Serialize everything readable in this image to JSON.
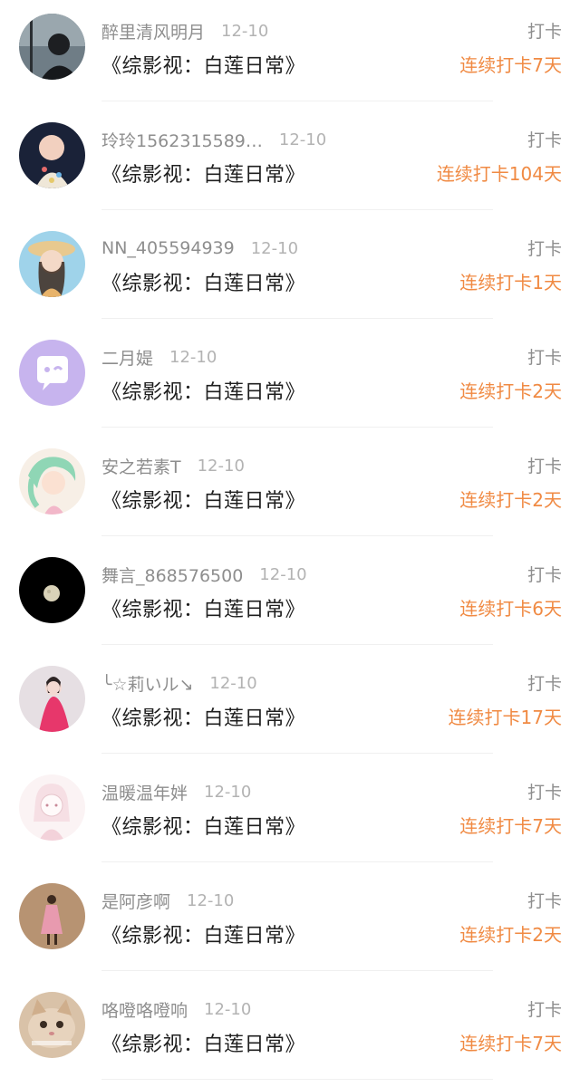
{
  "colors": {
    "streak": "#f08a43",
    "username": "#8e8e8e",
    "date": "#b3b3b3",
    "book": "#1f1f1f"
  },
  "feed": [
    {
      "username": "醉里清风明月",
      "date": "12-10",
      "book": "《综影视：白莲日常》",
      "action": "打卡",
      "streak": "连续打卡7天",
      "avatar": "dark-portrait"
    },
    {
      "username": "玲玲1562315589…",
      "date": "12-10",
      "book": "《综影视：白莲日常》",
      "action": "打卡",
      "streak": "连续打卡104天",
      "avatar": "baby-photo"
    },
    {
      "username": "NN_405594939",
      "date": "12-10",
      "book": "《综影视：白莲日常》",
      "action": "打卡",
      "streak": "连续打卡1天",
      "avatar": "girl-hat-photo"
    },
    {
      "username": "二月媞",
      "date": "12-10",
      "book": "《综影视：白莲日常》",
      "action": "打卡",
      "streak": "连续打卡2天",
      "avatar": "purple-chat-bubble"
    },
    {
      "username": "安之若素T",
      "date": "12-10",
      "book": "《综影视：白莲日常》",
      "action": "打卡",
      "streak": "连续打卡2天",
      "avatar": "anime-green-hair"
    },
    {
      "username": "舞言_868576500",
      "date": "12-10",
      "book": "《综影视：白莲日常》",
      "action": "打卡",
      "streak": "连续打卡6天",
      "avatar": "moon-black"
    },
    {
      "username": "╰☆莉いル↘",
      "date": "12-10",
      "book": "《综影视：白莲日常》",
      "action": "打卡",
      "streak": "连续打卡17天",
      "avatar": "pink-dress-girl"
    },
    {
      "username": "温暖温年姅",
      "date": "12-10",
      "book": "《综影视：白莲日常》",
      "action": "打卡",
      "streak": "连续打卡7天",
      "avatar": "anime-sketch-girl"
    },
    {
      "username": "是阿彦啊",
      "date": "12-10",
      "book": "《综影视：白莲日常》",
      "action": "打卡",
      "streak": "连续打卡2天",
      "avatar": "standing-girl-brown"
    },
    {
      "username": "咯噔咯噔响",
      "date": "12-10",
      "book": "《综影视：白莲日常》",
      "action": "打卡",
      "streak": "连续打卡7天",
      "avatar": "cat-photo"
    }
  ]
}
